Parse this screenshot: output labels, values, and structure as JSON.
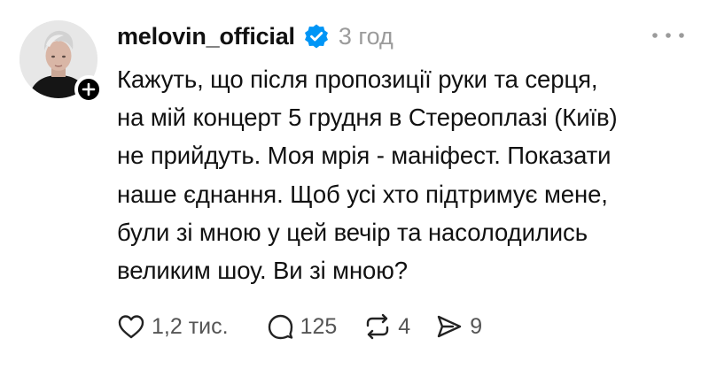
{
  "post": {
    "username": "melovin_official",
    "time": "3 год",
    "text_lines": [
      "Кажуть, що після пропозиції руки та серця,",
      "на мій концерт 5 грудня в Стереоплазі (Київ)",
      "не прийдуть. Моя мрія - маніфест. Показати",
      "наше єднання. Щоб усі хто підтримує мене,",
      "були зі мною у цей вечір та насолодились",
      "великим шоу. Ви зі мною?"
    ],
    "likes": "1,2 тис.",
    "replies": "125",
    "reposts": "4",
    "shares": "9"
  },
  "icons": {
    "verified": "verified-badge-icon",
    "more": "more-options-icon",
    "follow": "plus-icon",
    "like": "heart-icon",
    "reply": "comment-bubble-icon",
    "repost": "repost-icon",
    "share": "send-icon"
  },
  "colors": {
    "verified": "#0095f6",
    "muted": "#9b9b9b"
  }
}
